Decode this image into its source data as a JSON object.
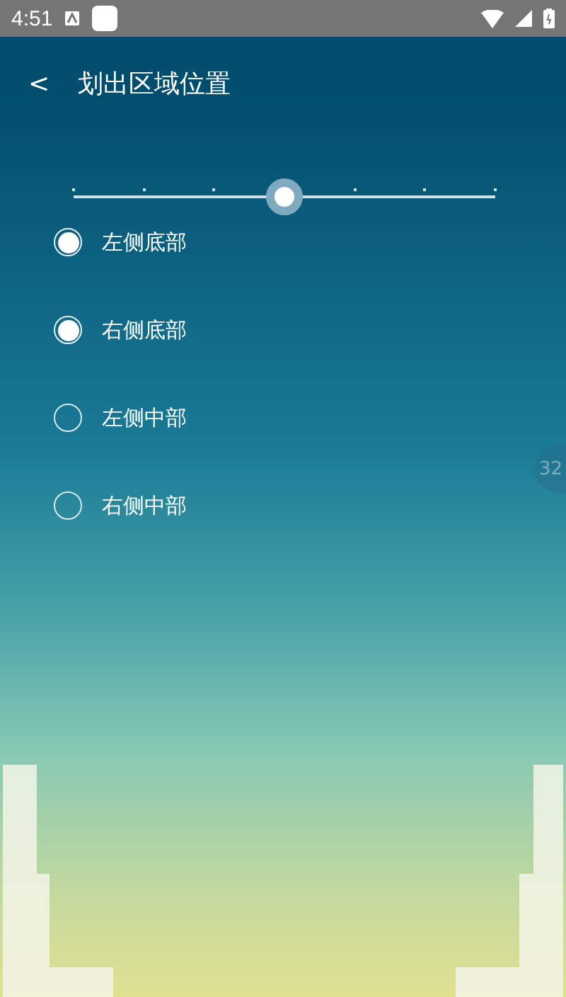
{
  "status_bar": {
    "time": "4:51"
  },
  "header": {
    "back": "<",
    "title": "划出区域位置"
  },
  "slider": {
    "level": 0.5
  },
  "options": [
    {
      "label": "左侧底部",
      "checked": true
    },
    {
      "label": "右侧底部",
      "checked": true
    },
    {
      "label": "左侧中部",
      "checked": false
    },
    {
      "label": "右侧中部",
      "checked": false
    }
  ],
  "edge_handle": {
    "text": "32"
  }
}
